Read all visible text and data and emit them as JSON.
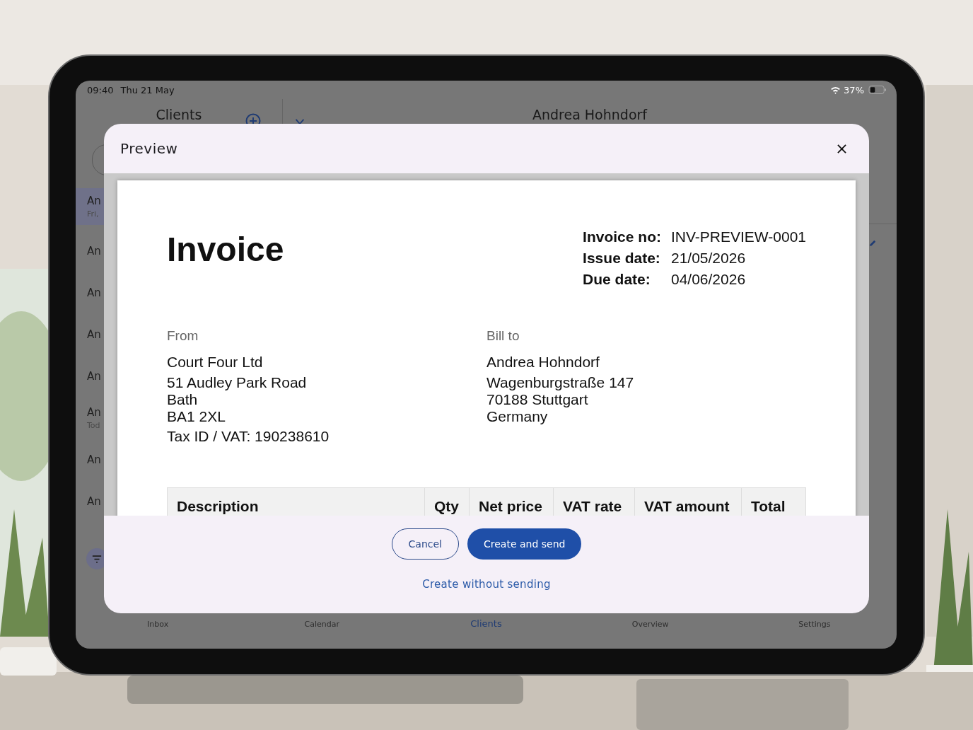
{
  "status_bar": {
    "time": "09:40",
    "date": "Thu 21 May",
    "battery_percent": "37%"
  },
  "sidebar": {
    "title": "Clients",
    "items": [
      {
        "name": "An",
        "subtitle": "Fri,",
        "selected": true
      },
      {
        "name": "An",
        "selected": false
      },
      {
        "name": "An",
        "selected": false
      },
      {
        "name": "An",
        "selected": false
      },
      {
        "name": "An",
        "selected": false
      },
      {
        "name": "An",
        "subtitle": "Tod",
        "selected": false
      },
      {
        "name": "An",
        "selected": false
      },
      {
        "name": "An",
        "selected": false
      }
    ]
  },
  "detail": {
    "title": "Andrea Hohndorf"
  },
  "tab_bar": [
    {
      "label": "Inbox",
      "selected": false
    },
    {
      "label": "Calendar",
      "selected": false
    },
    {
      "label": "Clients",
      "selected": true
    },
    {
      "label": "Overview",
      "selected": false
    },
    {
      "label": "Settings",
      "selected": false
    }
  ],
  "dialog": {
    "title": "Preview",
    "invoice": {
      "title": "Invoice",
      "meta": [
        {
          "label": "Invoice no:",
          "value": "INV-PREVIEW-0001"
        },
        {
          "label": "Issue date:",
          "value": "21/05/2026"
        },
        {
          "label": "Due date:",
          "value": "04/06/2026"
        }
      ],
      "from": {
        "heading": "From",
        "name": "Court Four Ltd",
        "address": [
          "51 Audley Park Road",
          "Bath",
          "BA1 2XL"
        ],
        "tax": "Tax ID / VAT: 190238610"
      },
      "bill_to": {
        "heading": "Bill to",
        "name": "Andrea Hohndorf",
        "address": [
          "Wagenburgstraße 147",
          "70188 Stuttgart",
          "Germany"
        ]
      },
      "table": {
        "columns": [
          "Description",
          "Qty",
          "Net price",
          "VAT rate",
          "VAT amount",
          "Total"
        ]
      }
    },
    "buttons": [
      {
        "label": "Cancel",
        "kind": "outlined"
      },
      {
        "label": "Create and send",
        "kind": "filled"
      },
      {
        "label": "Create without sending",
        "kind": "text"
      }
    ]
  }
}
